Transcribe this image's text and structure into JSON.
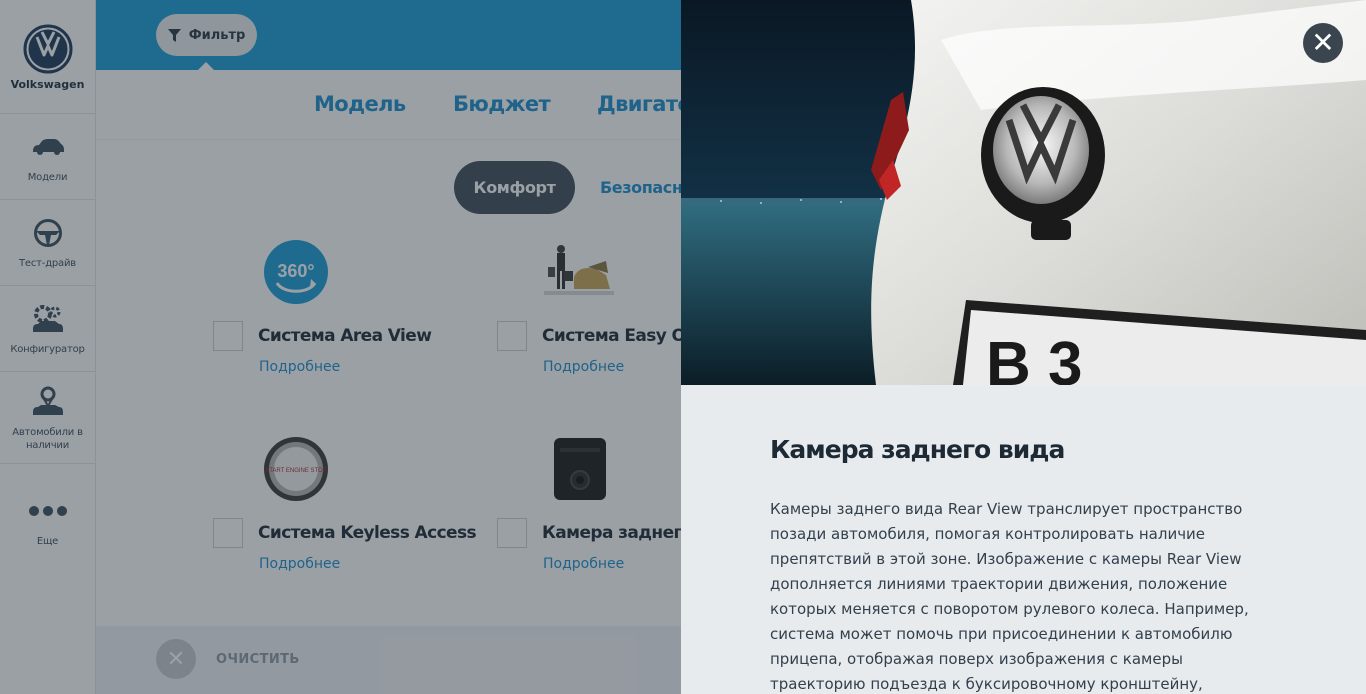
{
  "brand": {
    "name": "Volkswagen",
    "logo_icon": "vw-logo"
  },
  "sidebar": {
    "items": [
      {
        "label": "Модели",
        "icon": "car-icon"
      },
      {
        "label": "Тест-драйв",
        "icon": "steering-wheel-icon"
      },
      {
        "label": "Конфигуратор",
        "icon": "configurator-gears-icon"
      },
      {
        "label": "Автомобили в наличии",
        "icon": "person-car-icon"
      },
      {
        "label": "Еще",
        "icon": "more-dots-icon"
      }
    ]
  },
  "topbar": {
    "filter_label": "Фильтр",
    "accent": "#1b9dd8"
  },
  "categories": {
    "tabs": [
      "Модель",
      "Бюджет",
      "Двигате"
    ]
  },
  "subtabs": {
    "active": "Комфорт",
    "next": "Безопасно"
  },
  "options": [
    {
      "title": "Система Area View",
      "more": "Подробнее",
      "icon": "camera-360-icon",
      "icon_text": "360°"
    },
    {
      "title": "Система Easy Open",
      "more": "Подробнее",
      "icon": "easy-open-photo-icon"
    },
    {
      "title": "Система Keyless Access",
      "more": "Подробнее",
      "icon": "start-stop-button-icon",
      "icon_text": "START ENGINE STOP"
    },
    {
      "title": "Камера заднего ви",
      "more": "Подробнее",
      "icon": "rear-camera-icon"
    }
  ],
  "footer": {
    "clear_label": "ОЧИСТИТЬ"
  },
  "modal": {
    "title": "Камера заднего вида",
    "description": "Камеры заднего вида Rear View транслирует пространство позади автомобиля, помогая контролировать наличие препятствий в этой зоне. Изображение с камеры Rear View дополняется линиями траектории движения, положение которых меняется с поворотом рулевого колеса. Например, система может помочь при присоединении к автомобилю прицепа, отображая поверх изображения с камеры траекторию подъезда к буксировочному кронштейну, помогая таким образом водителю совершить точный",
    "plate_text": "B 3",
    "close_icon": "close-icon"
  }
}
